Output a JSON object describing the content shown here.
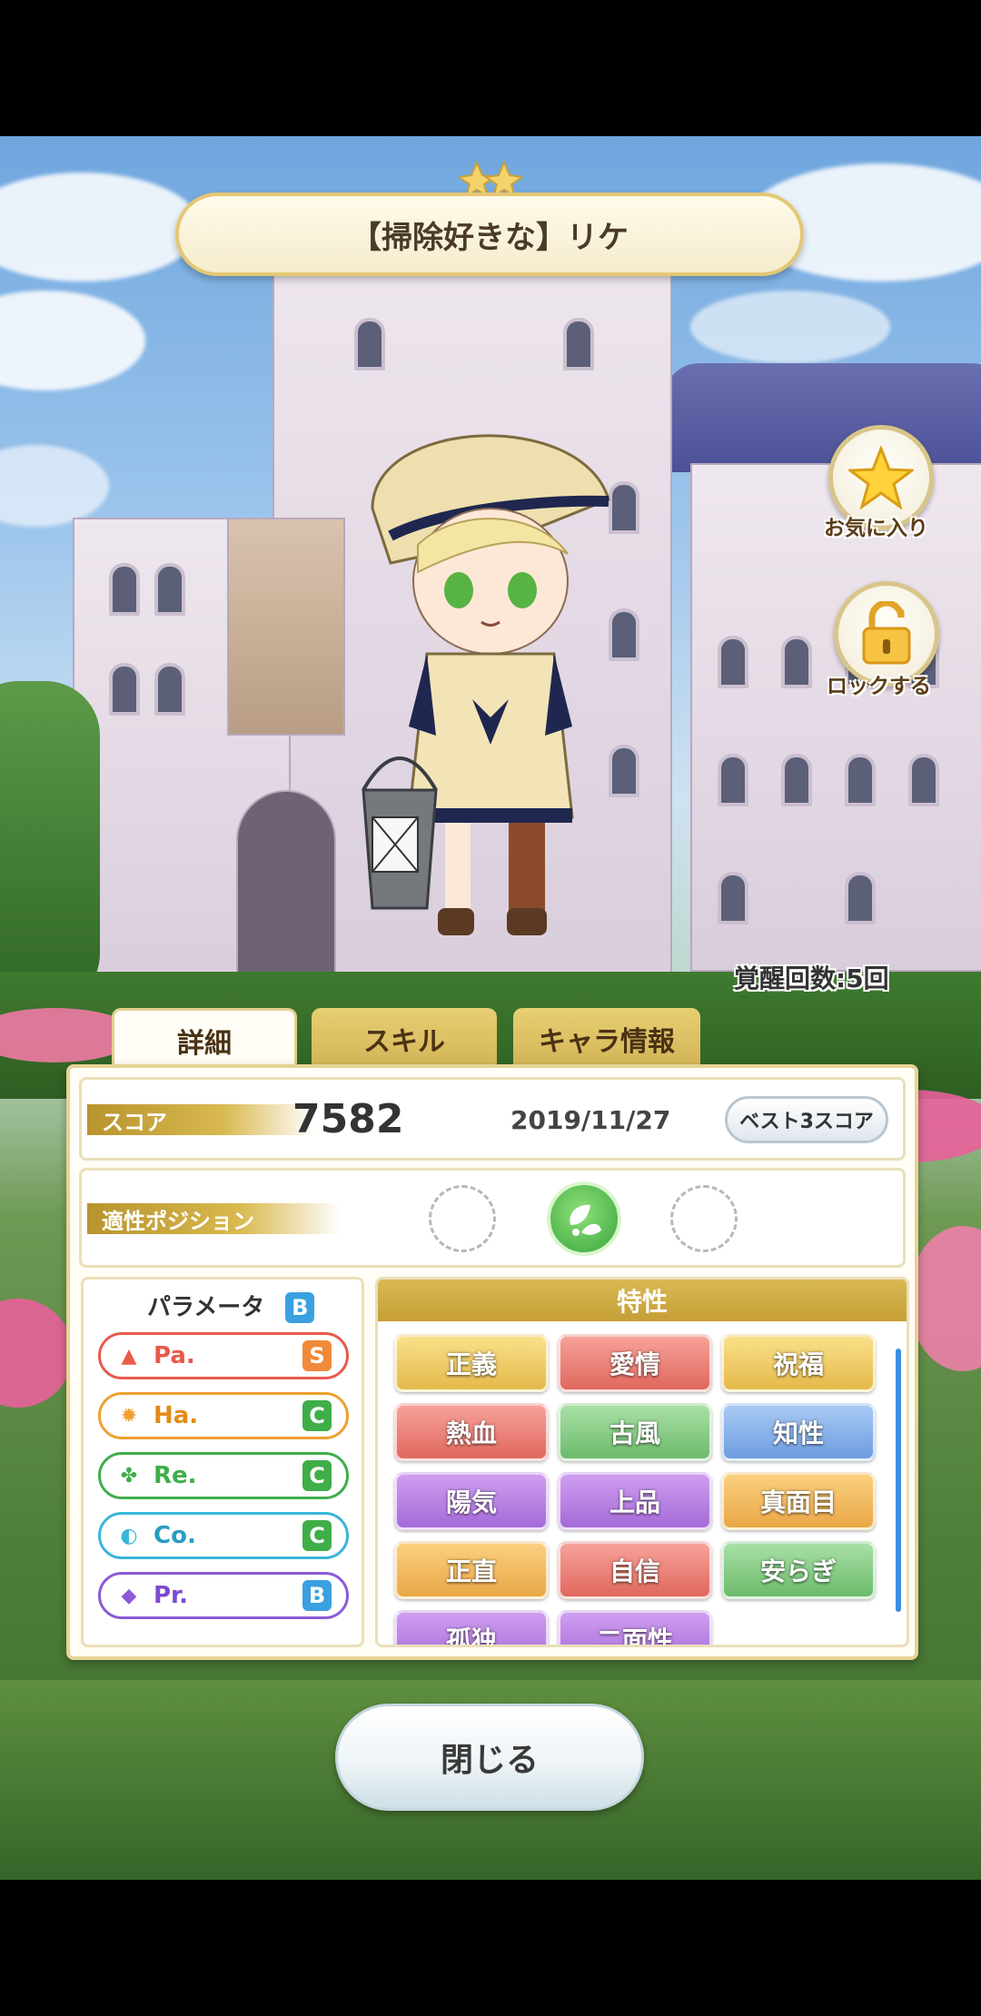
{
  "title": "【掃除好きな】リケ",
  "side_buttons": {
    "favorite_label": "お気に入り",
    "lock_label": "ロックする"
  },
  "awakening": "覚醒回数:5回",
  "tabs": [
    {
      "label": "詳細",
      "active": true
    },
    {
      "label": "スキル",
      "active": false
    },
    {
      "label": "キャラ情報",
      "active": false
    }
  ],
  "score": {
    "label": "スコア",
    "value": "7582",
    "date": "2019/11/27",
    "best_button": "ベスト3スコア"
  },
  "position": {
    "label": "適性ポジション"
  },
  "parameters": {
    "header": "パラメータ",
    "overall_grade": "B",
    "items": [
      {
        "name": "Pa.",
        "grade": "S",
        "color": "#e85a4a",
        "icon": "fire-icon"
      },
      {
        "name": "Ha.",
        "grade": "C",
        "color": "#f0a030",
        "icon": "sun-icon"
      },
      {
        "name": "Re.",
        "grade": "C",
        "color": "#3fae48",
        "icon": "clover-icon"
      },
      {
        "name": "Co.",
        "grade": "C",
        "color": "#38b6d8",
        "icon": "swirl-icon"
      },
      {
        "name": "Pr.",
        "grade": "B",
        "color": "#8c5ad8",
        "icon": "diamond-icon"
      }
    ]
  },
  "traits": {
    "header": "特性",
    "items": [
      {
        "label": "正義",
        "style": "gold"
      },
      {
        "label": "愛情",
        "style": "red"
      },
      {
        "label": "祝福",
        "style": "gold"
      },
      {
        "label": "熱血",
        "style": "red"
      },
      {
        "label": "古風",
        "style": "green"
      },
      {
        "label": "知性",
        "style": "blue"
      },
      {
        "label": "陽気",
        "style": "purple"
      },
      {
        "label": "上品",
        "style": "purple"
      },
      {
        "label": "真面目",
        "style": "orange"
      },
      {
        "label": "正直",
        "style": "orange"
      },
      {
        "label": "自信",
        "style": "red"
      },
      {
        "label": "安らぎ",
        "style": "green"
      },
      {
        "label": "孤独",
        "style": "purple"
      },
      {
        "label": "二面性",
        "style": "purple"
      }
    ]
  },
  "close_button": "閉じる"
}
